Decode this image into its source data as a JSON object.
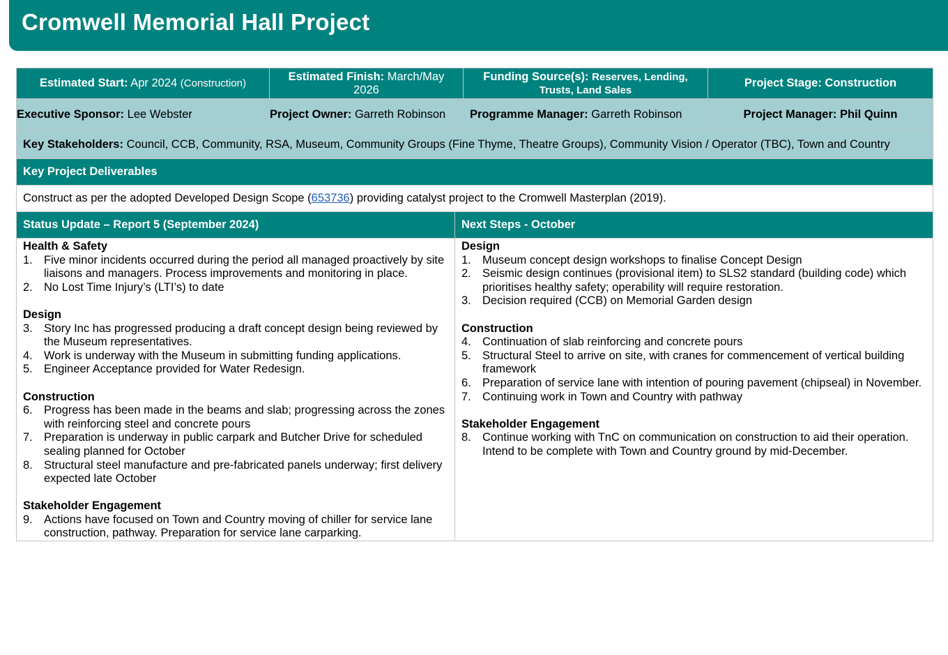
{
  "title": "Cromwell Memorial Hall Project",
  "row1": {
    "start_label": "Estimated Start:",
    "start_value": "Apr 2024",
    "start_note": "(Construction)",
    "finish_label": "Estimated Finish:",
    "finish_value": "March/May 2026",
    "funding_label": "Funding Source(s):",
    "funding_value": "Reserves, Lending, Trusts, Land Sales",
    "stage": "Project Stage: Construction"
  },
  "row2": {
    "sponsor_label": "Executive Sponsor:",
    "sponsor_value": "Lee Webster",
    "owner_label": "Project Owner:",
    "owner_value": "Garreth Robinson",
    "programme_label": "Programme Manager:",
    "programme_value": "Garreth Robinson",
    "pm": "Project Manager: Phil Quinn"
  },
  "stakeholders": {
    "label": "Key Stakeholders:",
    "value": "Council, CCB, Community, RSA, Museum, Community Groups (Fine Thyme, Theatre Groups), Community Vision / Operator (TBC), Town and Country"
  },
  "deliverables": {
    "heading": "Key Project Deliverables",
    "text_before": "Construct as per the adopted Developed Design Scope (",
    "link": "653736",
    "text_after": ") providing catalyst project to the Cromwell Masterplan (2019)."
  },
  "status": {
    "heading": "Status Update – Report 5 (September 2024)",
    "sections": [
      {
        "title": "Health & Safety",
        "items": [
          {
            "n": "1.",
            "text": "Five minor incidents occurred during the period all managed proactively by site liaisons and managers. Process improvements and monitoring in place."
          },
          {
            "n": "2.",
            "text": "No Lost Time Injury’s (LTI’s) to date"
          }
        ]
      },
      {
        "title": "Design",
        "items": [
          {
            "n": "3.",
            "text": "Story Inc has progressed producing a draft concept design being reviewed by the Museum representatives."
          },
          {
            "n": "4.",
            "text": "Work is underway with the Museum in submitting funding applications."
          },
          {
            "n": "5.",
            "text": "Engineer Acceptance provided for Water Redesign."
          }
        ]
      },
      {
        "title": "Construction",
        "items": [
          {
            "n": "6.",
            "text": "Progress has been made in the beams and slab; progressing across the zones with reinforcing steel and concrete pours"
          },
          {
            "n": "7.",
            "text": "Preparation is underway in public carpark and Butcher Drive for scheduled sealing planned for October"
          },
          {
            "n": "8.",
            "text": "Structural steel manufacture and pre-fabricated panels underway; first delivery expected late October"
          }
        ]
      },
      {
        "title": "Stakeholder Engagement",
        "items": [
          {
            "n": "9.",
            "text": "Actions have focused on Town and Country moving of chiller for service lane construction, pathway. Preparation for service lane carparking."
          }
        ]
      }
    ]
  },
  "next": {
    "heading": "Next Steps - October",
    "sections": [
      {
        "title": "Design",
        "items": [
          {
            "n": "1.",
            "text": "Museum concept design workshops to finalise Concept Design"
          },
          {
            "n": "2.",
            "text": "Seismic design continues (provisional item) to SLS2 standard (building code) which prioritises healthy safety; operability will require restoration."
          },
          {
            "n": "3.",
            "text": "Decision required (CCB) on Memorial Garden design"
          }
        ]
      },
      {
        "title": "Construction",
        "items": [
          {
            "n": "4.",
            "text": "Continuation of slab reinforcing and concrete pours"
          },
          {
            "n": "5.",
            "text": "Structural Steel to arrive on site, with cranes for commencement of vertical building framework"
          },
          {
            "n": "6.",
            "text": "Preparation of service lane with intention of pouring pavement (chipseal) in November."
          },
          {
            "n": "7.",
            "text": "Continuing work in Town and Country with pathway"
          }
        ]
      },
      {
        "title": "Stakeholder Engagement",
        "items": [
          {
            "n": "8.",
            "text": "Continue working with TnC on communication on construction to aid their operation. Intend to be complete with Town and Country ground by mid-December."
          }
        ]
      }
    ]
  }
}
